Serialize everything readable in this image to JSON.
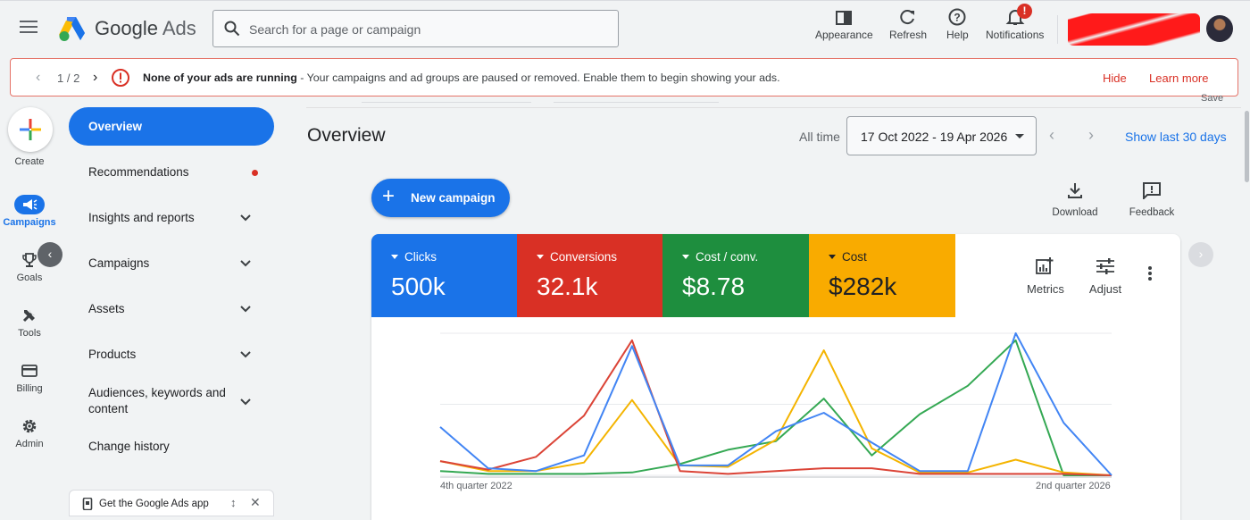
{
  "header": {
    "product_name_1": "Google",
    "product_name_2": "Ads",
    "search_placeholder": "Search for a page or campaign",
    "buttons": [
      {
        "label": "Appearance",
        "icon": "appearance-icon"
      },
      {
        "label": "Refresh",
        "icon": "refresh-icon"
      },
      {
        "label": "Help",
        "icon": "help-icon"
      },
      {
        "label": "Notifications",
        "icon": "bell-icon"
      }
    ],
    "notification_badge": "!"
  },
  "alert": {
    "pager": "1 / 2",
    "title": "None of your ads are running",
    "message": " - Your campaigns and ad groups are paused or removed. Enable them to begin showing your ads.",
    "hide": "Hide",
    "learn_more": "Learn more",
    "save_fragment": "Save"
  },
  "rail": {
    "create": "Create",
    "items": [
      {
        "label": "Campaigns",
        "icon": "megaphone-icon",
        "active": true
      },
      {
        "label": "Goals",
        "icon": "trophy-icon"
      },
      {
        "label": "Tools",
        "icon": "tools-icon"
      },
      {
        "label": "Billing",
        "icon": "credit-card-icon"
      },
      {
        "label": "Admin",
        "icon": "gear-icon"
      }
    ]
  },
  "nav": {
    "items": [
      {
        "label": "Overview",
        "active": true
      },
      {
        "label": "Recommendations",
        "dot": true
      },
      {
        "label": "Insights and reports",
        "expandable": true
      },
      {
        "label": "Campaigns",
        "expandable": true
      },
      {
        "label": "Assets",
        "expandable": true
      },
      {
        "label": "Products",
        "expandable": true
      },
      {
        "label": "Audiences, keywords and content",
        "expandable": true
      },
      {
        "label": "Change history"
      }
    ],
    "app_promo": "Get the Google Ads app"
  },
  "main": {
    "title": "Overview",
    "range_label": "All time",
    "date_range": "17 Oct 2022 - 19 Apr 2026",
    "show_last": "Show last 30 days",
    "new_campaign": "New campaign",
    "download": "Download",
    "feedback": "Feedback"
  },
  "metrics": [
    {
      "name": "Clicks",
      "value": "500k",
      "color": "#1a73e8"
    },
    {
      "name": "Conversions",
      "value": "32.1k",
      "color": "#d93025"
    },
    {
      "name": "Cost / conv.",
      "value": "$8.78",
      "color": "#1e8e3e"
    },
    {
      "name": "Cost",
      "value": "$282k",
      "color": "#f9ab00"
    }
  ],
  "card_tools": {
    "metrics": "Metrics",
    "adjust": "Adjust"
  },
  "chart_data": {
    "type": "line",
    "x_start_label": "4th quarter 2022",
    "x_end_label": "2nd quarter 2026",
    "x": [
      0,
      1,
      2,
      3,
      4,
      5,
      6,
      7,
      8,
      9,
      10,
      11,
      12,
      13,
      14
    ],
    "grid": true,
    "series": [
      {
        "name": "Clicks",
        "color": "#4285f4",
        "values": [
          34,
          5,
          3,
          14,
          91,
          7,
          7,
          31,
          44,
          23,
          3,
          3,
          100,
          37,
          0
        ]
      },
      {
        "name": "Conversions",
        "color": "#db4437",
        "values": [
          10,
          4,
          13,
          42,
          95,
          3,
          1,
          3,
          5,
          5,
          1,
          1,
          1,
          1,
          0
        ]
      },
      {
        "name": "Cost / conv.",
        "color": "#34a853",
        "values": [
          3,
          1,
          1,
          1,
          2,
          8,
          18,
          24,
          54,
          14,
          43,
          63,
          95,
          0,
          0
        ]
      },
      {
        "name": "Cost",
        "color": "#f4b400",
        "values": [
          10,
          3,
          3,
          9,
          53,
          7,
          6,
          25,
          88,
          19,
          2,
          2,
          11,
          2,
          0
        ]
      }
    ]
  }
}
